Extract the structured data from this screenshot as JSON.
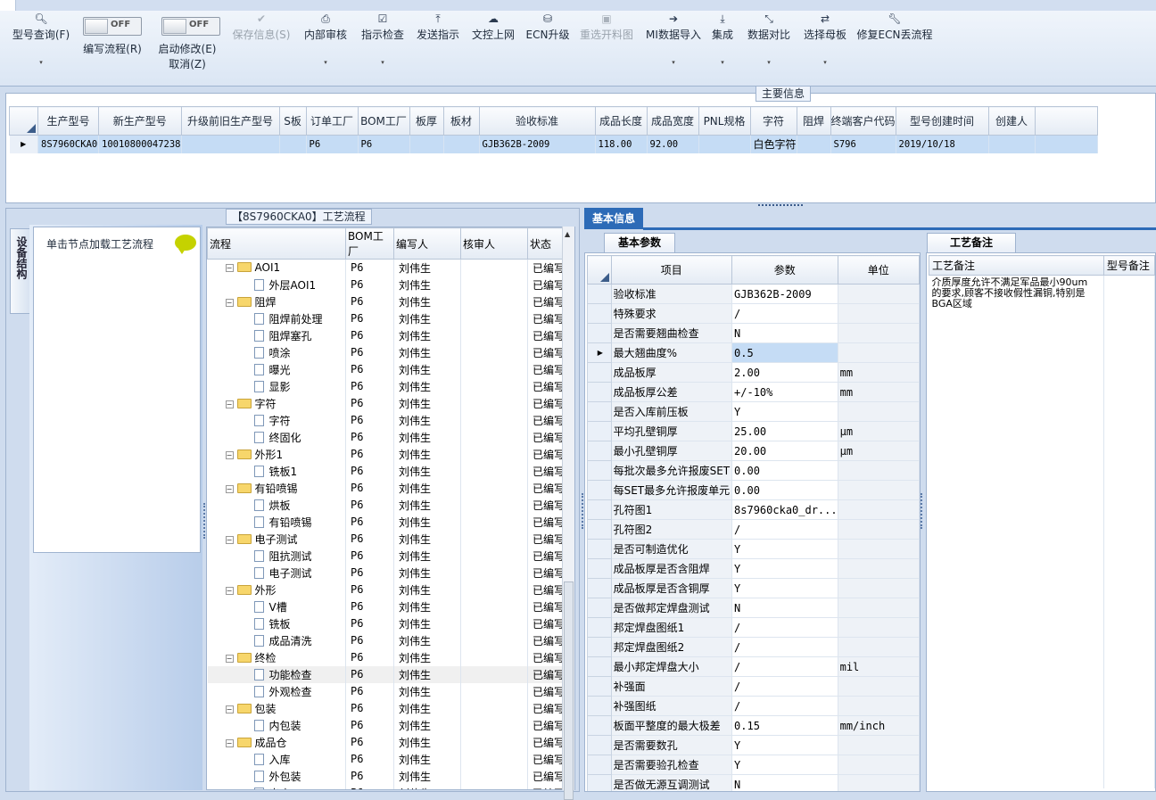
{
  "toolbar": {
    "buttons": [
      {
        "label": "型号查询(F)",
        "icon": "search-icon",
        "glyph": "🔍︎",
        "dropdown": true
      },
      {
        "label": "保存信息(S)",
        "icon": "check-icon",
        "glyph": "✔",
        "disabled": true
      },
      {
        "label": "内部审核",
        "icon": "print-icon",
        "glyph": "⎙",
        "dropdown": true
      },
      {
        "label": "指示检查",
        "icon": "checkbox-icon",
        "glyph": "☑",
        "dropdown": true
      },
      {
        "label": "发送指示",
        "icon": "upload-icon",
        "glyph": "⤒"
      },
      {
        "label": "文控上网",
        "icon": "cloud-upload-icon",
        "glyph": "☁"
      },
      {
        "label": "ECN升级",
        "icon": "binoculars-icon",
        "glyph": "⛁"
      },
      {
        "label": "重选开料图",
        "icon": "image-icon",
        "glyph": "▣",
        "disabled": true
      },
      {
        "label": "MI数据导入",
        "icon": "import-icon",
        "glyph": "➔",
        "dropdown": true
      },
      {
        "label": "集成",
        "icon": "download-icon",
        "glyph": "⤓",
        "dropdown": true
      },
      {
        "label": "数据对比",
        "icon": "compress-icon",
        "glyph": "⤡",
        "dropdown": true
      },
      {
        "label": "选择母板",
        "icon": "shuffle-icon",
        "glyph": "⇄",
        "dropdown": true
      },
      {
        "label": "修复ECN丢流程",
        "icon": "wrench-icon",
        "glyph": "🔧︎"
      }
    ],
    "toggle_edit_flow": {
      "state": "OFF",
      "label": "编写流程(R)"
    },
    "toggle_modify": {
      "state": "OFF",
      "label": "启动修改(E)",
      "label2": "取消(Z)"
    }
  },
  "main_info": {
    "title": "主要信息",
    "columns": [
      "生产型号",
      "新生产型号",
      "升级前旧生产型号",
      "S板",
      "订单工厂",
      "BOM工厂",
      "板厚",
      "板材",
      "验收标准",
      "成品长度",
      "成品宽度",
      "PNL规格",
      "字符",
      "阻焊",
      "终端客户代码",
      "型号创建时间",
      "创建人"
    ],
    "row": [
      "8S7960CKA0",
      "10010800047238",
      "",
      "",
      "P6",
      "P6",
      "",
      "",
      "GJB362B-2009",
      "118.00",
      "92.00",
      "",
      "白色字符",
      "",
      "S796",
      "2019/10/18",
      ""
    ]
  },
  "flow": {
    "title": "【8S7960CKA0】工艺流程",
    "side_tab": "设备结构",
    "hint": "单击节点加载工艺流程",
    "columns": [
      "流程",
      "BOM工厂",
      "编写人",
      "核审人",
      "状态"
    ],
    "rows": [
      {
        "name": "AOI1",
        "level": 1,
        "folder": true,
        "bom": "P6",
        "writer": "刘伟生",
        "status": "已编写"
      },
      {
        "name": "外层AOI1",
        "level": 2,
        "bom": "P6",
        "writer": "刘伟生",
        "status": "已编写"
      },
      {
        "name": "阻焊",
        "level": 1,
        "folder": true,
        "bom": "P6",
        "writer": "刘伟生",
        "status": "已编写"
      },
      {
        "name": "阻焊前处理",
        "level": 2,
        "bom": "P6",
        "writer": "刘伟生",
        "status": "已编写"
      },
      {
        "name": "阻焊塞孔",
        "level": 2,
        "bom": "P6",
        "writer": "刘伟生",
        "status": "已编写"
      },
      {
        "name": "喷涂",
        "level": 2,
        "bom": "P6",
        "writer": "刘伟生",
        "status": "已编写"
      },
      {
        "name": "曝光",
        "level": 2,
        "bom": "P6",
        "writer": "刘伟生",
        "status": "已编写"
      },
      {
        "name": "显影",
        "level": 2,
        "bom": "P6",
        "writer": "刘伟生",
        "status": "已编写"
      },
      {
        "name": "字符",
        "level": 1,
        "folder": true,
        "bom": "P6",
        "writer": "刘伟生",
        "status": "已编写"
      },
      {
        "name": "字符",
        "level": 2,
        "bom": "P6",
        "writer": "刘伟生",
        "status": "已编写"
      },
      {
        "name": "终固化",
        "level": 2,
        "bom": "P6",
        "writer": "刘伟生",
        "status": "已编写"
      },
      {
        "name": "外形1",
        "level": 1,
        "folder": true,
        "bom": "P6",
        "writer": "刘伟生",
        "status": "已编写"
      },
      {
        "name": "铣板1",
        "level": 2,
        "bom": "P6",
        "writer": "刘伟生",
        "status": "已编写"
      },
      {
        "name": "有铅喷锡",
        "level": 1,
        "folder": true,
        "bom": "P6",
        "writer": "刘伟生",
        "status": "已编写"
      },
      {
        "name": "烘板",
        "level": 2,
        "bom": "P6",
        "writer": "刘伟生",
        "status": "已编写"
      },
      {
        "name": "有铅喷锡",
        "level": 2,
        "bom": "P6",
        "writer": "刘伟生",
        "status": "已编写"
      },
      {
        "name": "电子测试",
        "level": 1,
        "folder": true,
        "bom": "P6",
        "writer": "刘伟生",
        "status": "已编写"
      },
      {
        "name": "阻抗测试",
        "level": 2,
        "bom": "P6",
        "writer": "刘伟生",
        "status": "已编写"
      },
      {
        "name": "电子测试",
        "level": 2,
        "bom": "P6",
        "writer": "刘伟生",
        "status": "已编写"
      },
      {
        "name": "外形",
        "level": 1,
        "folder": true,
        "bom": "P6",
        "writer": "刘伟生",
        "status": "已编写"
      },
      {
        "name": "V槽",
        "level": 2,
        "bom": "P6",
        "writer": "刘伟生",
        "status": "已编写"
      },
      {
        "name": "铣板",
        "level": 2,
        "bom": "P6",
        "writer": "刘伟生",
        "status": "已编写"
      },
      {
        "name": "成品清洗",
        "level": 2,
        "bom": "P6",
        "writer": "刘伟生",
        "status": "已编写"
      },
      {
        "name": "终检",
        "level": 1,
        "folder": true,
        "bom": "P6",
        "writer": "刘伟生",
        "status": "已编写"
      },
      {
        "name": "功能检查",
        "level": 2,
        "bom": "P6",
        "writer": "刘伟生",
        "status": "已编写",
        "selected": true
      },
      {
        "name": "外观检查",
        "level": 2,
        "bom": "P6",
        "writer": "刘伟生",
        "status": "已编写"
      },
      {
        "name": "包装",
        "level": 1,
        "folder": true,
        "bom": "P6",
        "writer": "刘伟生",
        "status": "已编写"
      },
      {
        "name": "内包装",
        "level": 2,
        "bom": "P6",
        "writer": "刘伟生",
        "status": "已编写"
      },
      {
        "name": "成品仓",
        "level": 1,
        "folder": true,
        "bom": "P6",
        "writer": "刘伟生",
        "status": "已编写"
      },
      {
        "name": "入库",
        "level": 2,
        "bom": "P6",
        "writer": "刘伟生",
        "status": "已编写"
      },
      {
        "name": "外包装",
        "level": 2,
        "bom": "P6",
        "writer": "刘伟生",
        "status": "已编写"
      },
      {
        "name": "出库",
        "level": 2,
        "bom": "P6",
        "writer": "刘伟生",
        "status": "已编写"
      }
    ]
  },
  "basic_info": {
    "tab": "基本信息",
    "params_tab": "基本参数",
    "columns": [
      "项目",
      "参数",
      "单位"
    ],
    "rows": [
      {
        "item": "验收标准",
        "value": "GJB362B-2009",
        "unit": ""
      },
      {
        "item": "特殊要求",
        "value": "/",
        "unit": ""
      },
      {
        "item": "是否需要翘曲检查",
        "value": "N",
        "unit": ""
      },
      {
        "item": "最大翘曲度%",
        "value": "0.5",
        "unit": "",
        "current": true
      },
      {
        "item": "成品板厚",
        "value": "2.00",
        "unit": "mm"
      },
      {
        "item": "成品板厚公差",
        "value": "+/-10%",
        "unit": "mm"
      },
      {
        "item": "是否入库前压板",
        "value": "Y",
        "unit": ""
      },
      {
        "item": "平均孔壁铜厚",
        "value": "25.00",
        "unit": "μm"
      },
      {
        "item": "最小孔壁铜厚",
        "value": "20.00",
        "unit": "μm"
      },
      {
        "item": "每批次最多允许报废SET",
        "value": "0.00",
        "unit": ""
      },
      {
        "item": "每SET最多允许报废单元",
        "value": "0.00",
        "unit": ""
      },
      {
        "item": "孔符图1",
        "value": "8s7960cka0_dr...",
        "unit": ""
      },
      {
        "item": "孔符图2",
        "value": "/",
        "unit": ""
      },
      {
        "item": "是否可制造优化",
        "value": "Y",
        "unit": ""
      },
      {
        "item": "成品板厚是否含阻焊",
        "value": "Y",
        "unit": ""
      },
      {
        "item": "成品板厚是否含铜厚",
        "value": "Y",
        "unit": ""
      },
      {
        "item": "是否做邦定焊盘测试",
        "value": "N",
        "unit": ""
      },
      {
        "item": "邦定焊盘图纸1",
        "value": "/",
        "unit": ""
      },
      {
        "item": "邦定焊盘图纸2",
        "value": "/",
        "unit": ""
      },
      {
        "item": "最小邦定焊盘大小",
        "value": "/",
        "unit": "mil"
      },
      {
        "item": "补强面",
        "value": "/",
        "unit": ""
      },
      {
        "item": "补强图纸",
        "value": "/",
        "unit": ""
      },
      {
        "item": "板面平整度的最大极差",
        "value": "0.15",
        "unit": "mm/inch"
      },
      {
        "item": "是否需要数孔",
        "value": "Y",
        "unit": ""
      },
      {
        "item": "是否需要验孔检查",
        "value": "Y",
        "unit": ""
      },
      {
        "item": "是否做无源互调测试",
        "value": "N",
        "unit": ""
      }
    ]
  },
  "notes": {
    "tab": "工艺备注",
    "columns": [
      "工艺备注",
      "型号备注"
    ],
    "process_note": "介质厚度允许不满足军品最小90um的要求,顾客不接收假性漏铜,特别是BGA区域",
    "model_note": ""
  }
}
